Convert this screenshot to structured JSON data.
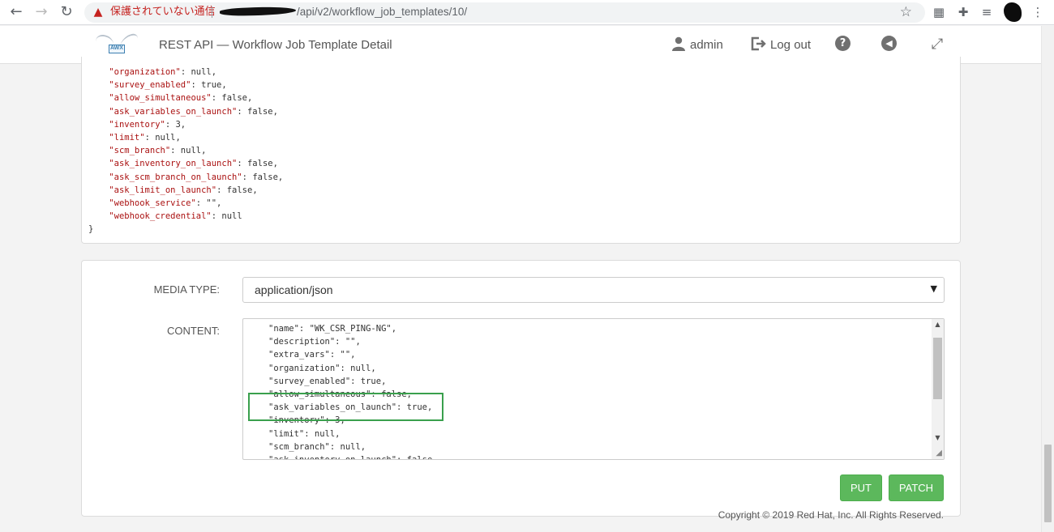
{
  "browser": {
    "security_warning": "保護されていない通信",
    "url_path": "/api/v2/workflow_job_templates/10/"
  },
  "header": {
    "title": "REST API — Workflow Job Template Detail",
    "user": "admin",
    "logout": "Log out"
  },
  "response_json": {
    "lines": [
      {
        "key": "\"organization\"",
        "value": ": null,"
      },
      {
        "key": "\"survey_enabled\"",
        "value": ": true,"
      },
      {
        "key": "\"allow_simultaneous\"",
        "value": ": false,"
      },
      {
        "key": "\"ask_variables_on_launch\"",
        "value": ": false,"
      },
      {
        "key": "\"inventory\"",
        "value": ": 3,"
      },
      {
        "key": "\"limit\"",
        "value": ": null,"
      },
      {
        "key": "\"scm_branch\"",
        "value": ": null,"
      },
      {
        "key": "\"ask_inventory_on_launch\"",
        "value": ": false,"
      },
      {
        "key": "\"ask_scm_branch_on_launch\"",
        "value": ": false,"
      },
      {
        "key": "\"ask_limit_on_launch\"",
        "value": ": false,"
      },
      {
        "key": "\"webhook_service\"",
        "value": ": \"\","
      },
      {
        "key": "\"webhook_credential\"",
        "value": ": null"
      }
    ],
    "closing_brace": "}"
  },
  "form": {
    "media_type_label": "MEDIA TYPE:",
    "media_type_value": "application/json",
    "content_label": "CONTENT:",
    "content_lines": [
      "\"name\": \"WK_CSR_PING-NG\",",
      "\"description\": \"\",",
      "\"extra_vars\": \"\",",
      "\"organization\": null,",
      "\"survey_enabled\": true,",
      "\"allow_simultaneous\": false,",
      "\"ask_variables_on_launch\": true,",
      "\"inventory\": 3,",
      "\"limit\": null,",
      "\"scm_branch\": null,",
      "\"ask_inventory_on_launch\": false,"
    ],
    "put_label": "PUT",
    "patch_label": "PATCH"
  },
  "footer": {
    "copyright": "Copyright © 2019 Red Hat, Inc. All Rights Reserved."
  },
  "colors": {
    "button_green": "#5cb85c",
    "highlight_green": "#3aa04d",
    "json_key": "#aa1111"
  }
}
